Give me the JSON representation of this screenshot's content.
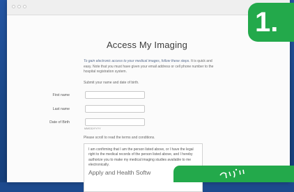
{
  "page": {
    "title": "Access My Imaging",
    "intro_line1": "To gain electronic access to your medical images, follow these steps.",
    "intro_rest": "It is quick and easy. Note that you must have given your email address or cell phone number to the hospital registration system.",
    "submit_instructions": "Submit your name and date of birth."
  },
  "form": {
    "first_name_label": "First name",
    "first_name_value": "",
    "last_name_label": "Last name",
    "last_name_value": "",
    "dob_label": "Date of Birth",
    "dob_value": "",
    "dob_hint": "MM/DD/YYYY"
  },
  "terms": {
    "scroll_note": "Please scroll to read the terms and conditions.",
    "body": "I am confirming that I am the person listed above, or I have the legal right to the medical records of the person listed above, and I hereby authorize you to make my medical imaging studies available to me electronically.",
    "heading_partial": "Apply and Health Softw"
  },
  "step_badge": {
    "number": "1."
  },
  "colors": {
    "background_blue": "#1d4a8e",
    "badge_green": "#23a94b",
    "window_bg": "#fbfbfb"
  },
  "icons": {
    "window_controls": "traffic-light-dots",
    "overlay_graphic": "celebration-lines-icon"
  }
}
